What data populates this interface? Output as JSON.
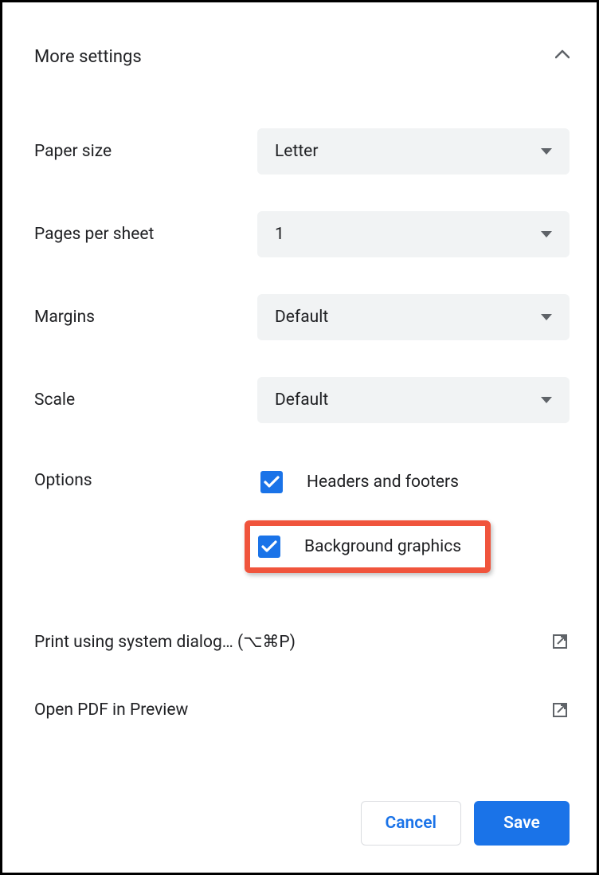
{
  "header": {
    "title": "More settings"
  },
  "settings": {
    "paper_size": {
      "label": "Paper size",
      "value": "Letter"
    },
    "pages_per_sheet": {
      "label": "Pages per sheet",
      "value": "1"
    },
    "margins": {
      "label": "Margins",
      "value": "Default"
    },
    "scale": {
      "label": "Scale",
      "value": "Default"
    }
  },
  "options": {
    "label": "Options",
    "headers_and_footers": {
      "label": "Headers and footers",
      "checked": true
    },
    "background_graphics": {
      "label": "Background graphics",
      "checked": true
    }
  },
  "links": {
    "system_dialog": "Print using system dialog… (⌥⌘P)",
    "open_pdf": "Open PDF in Preview"
  },
  "buttons": {
    "cancel": "Cancel",
    "save": "Save"
  }
}
